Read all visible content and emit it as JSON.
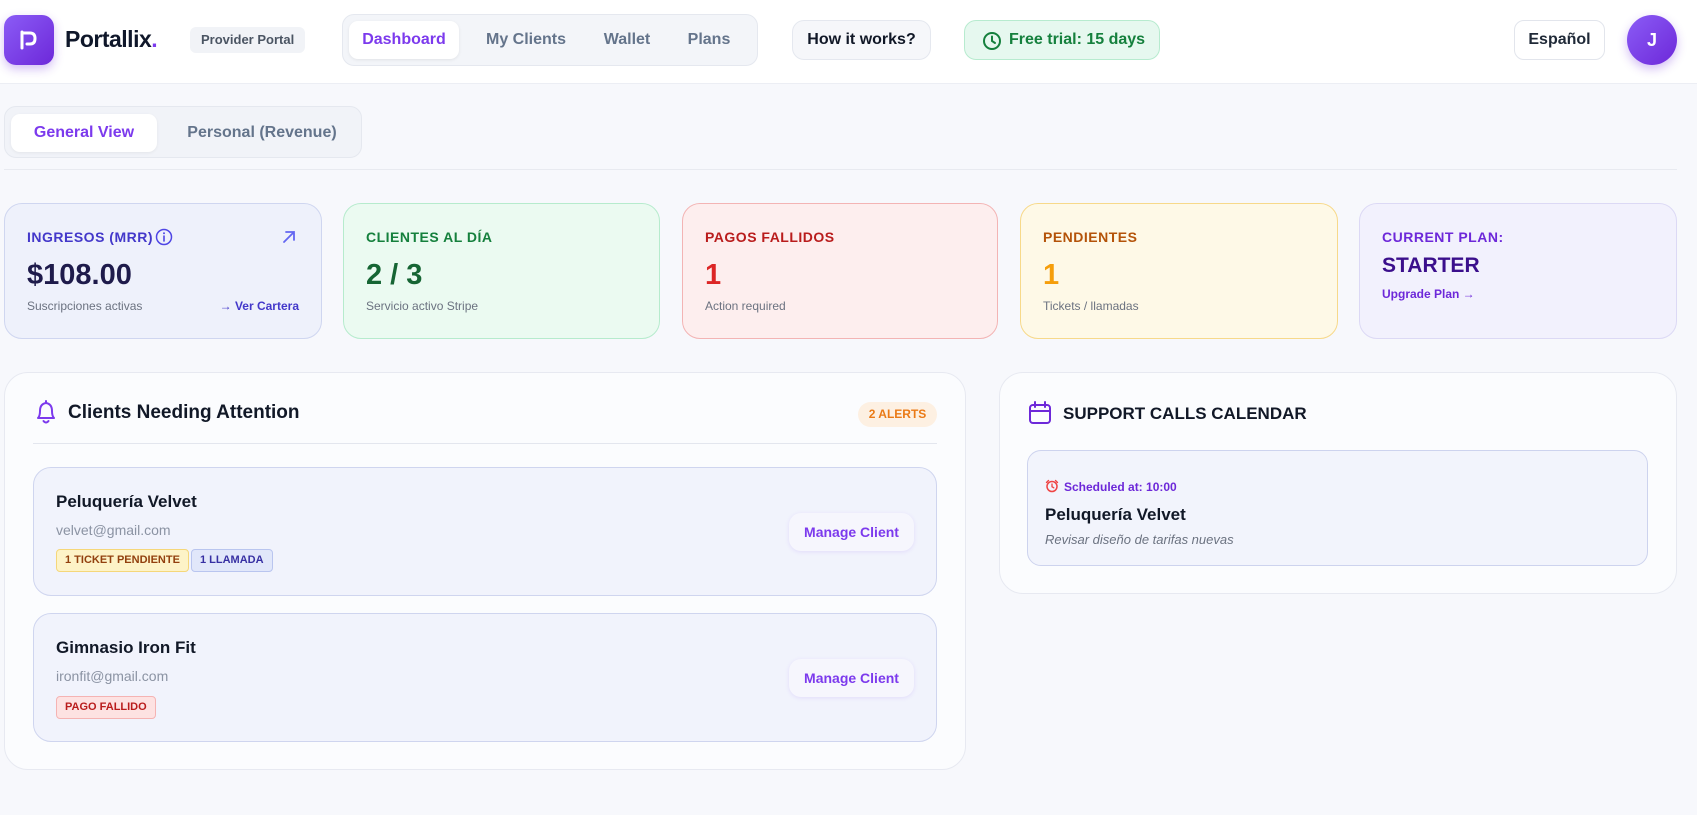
{
  "header": {
    "brand": "Portallix",
    "brand_dot": ".",
    "portal_tag": "Provider Portal",
    "nav": [
      "Dashboard",
      "My Clients",
      "Wallet",
      "Plans"
    ],
    "how_label": "How it works?",
    "trial_label": "Free trial: 15 days",
    "language": "Español",
    "avatar_initial": "J"
  },
  "view_tabs": [
    "General View",
    "Personal (Revenue)"
  ],
  "kpis": {
    "mrr": {
      "label": "INGRESOS (MRR)",
      "value": "$108.00",
      "sub": "Suscripciones activas",
      "link": "→ Ver Cartera"
    },
    "clients": {
      "label": "CLIENTES AL DÍA",
      "value": "2 / 3",
      "sub": "Servicio activo Stripe"
    },
    "failed": {
      "label": "PAGOS FALLIDOS",
      "value": "1",
      "sub": "Action required"
    },
    "pending": {
      "label": "PENDIENTES",
      "value": "1",
      "sub": "Tickets / llamadas"
    },
    "plan": {
      "label": "CURRENT PLAN:",
      "value": "STARTER",
      "link": "Upgrade Plan →"
    }
  },
  "attention": {
    "title": "Clients Needing Attention",
    "badge": "2 ALERTS",
    "clients": [
      {
        "name": "Peluquería Velvet",
        "email": "velvet@gmail.com",
        "tags": [
          "1 TICKET PENDIENTE",
          "1 LLAMADA"
        ],
        "button": "Manage Client"
      },
      {
        "name": "Gimnasio Iron Fit",
        "email": "ironfit@gmail.com",
        "tags": [
          "PAGO FALLIDO"
        ],
        "button": "Manage Client"
      }
    ]
  },
  "calendar": {
    "title": "SUPPORT CALLS CALENDAR",
    "event": {
      "time": "Scheduled at: 10:00",
      "name": "Peluquería Velvet",
      "description": "Revisar diseño de tarifas nuevas"
    }
  },
  "colors": {
    "accent": "#7c3aed",
    "success": "#15803d",
    "danger": "#dc2626",
    "warning": "#f59e0b"
  }
}
